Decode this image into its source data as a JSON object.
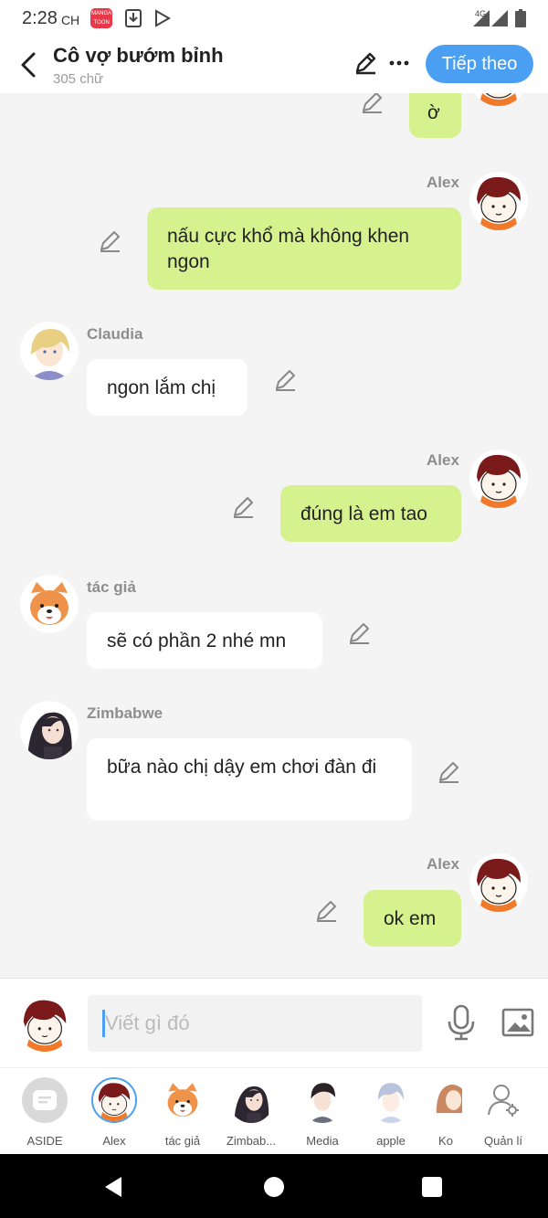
{
  "status_bar": {
    "time": "2:28",
    "ampm": "CH",
    "app_icon_text": "MANGA TOON",
    "network": "4G"
  },
  "header": {
    "title": "Cô vợ bướm bỉnh",
    "subtitle": "305 chữ",
    "next_label": "Tiếp theo"
  },
  "messages": [
    {
      "sender": "",
      "text": "ờ",
      "mine": true
    },
    {
      "sender": "Alex",
      "text": "nấu cực khổ mà không khen ngon",
      "mine": true
    },
    {
      "sender": "Claudia",
      "text": "ngon lắm chị",
      "mine": false
    },
    {
      "sender": "Alex",
      "text": "đúng là em tao",
      "mine": true
    },
    {
      "sender": "tác giả",
      "text": "sẽ có phần 2 nhé mn",
      "mine": false
    },
    {
      "sender": "Zimbabwe",
      "text": "bữa nào chị dậy em chơi đàn đi",
      "mine": false
    },
    {
      "sender": "Alex",
      "text": "ok em",
      "mine": true
    }
  ],
  "composer": {
    "placeholder": "Viết gì đó"
  },
  "characters": [
    {
      "label": "ASIDE"
    },
    {
      "label": "Alex"
    },
    {
      "label": "tác giả"
    },
    {
      "label": "Zimbab..."
    },
    {
      "label": "Media"
    },
    {
      "label": "apple"
    },
    {
      "label": "Ko"
    },
    {
      "label": "Quản lí"
    }
  ],
  "colors": {
    "accent": "#4a9ff2",
    "mine_bubble": "#d6f28f",
    "their_bubble": "#ffffff",
    "alex_hair": "#7a1a1a",
    "alex_shirt": "#f07a2a"
  }
}
